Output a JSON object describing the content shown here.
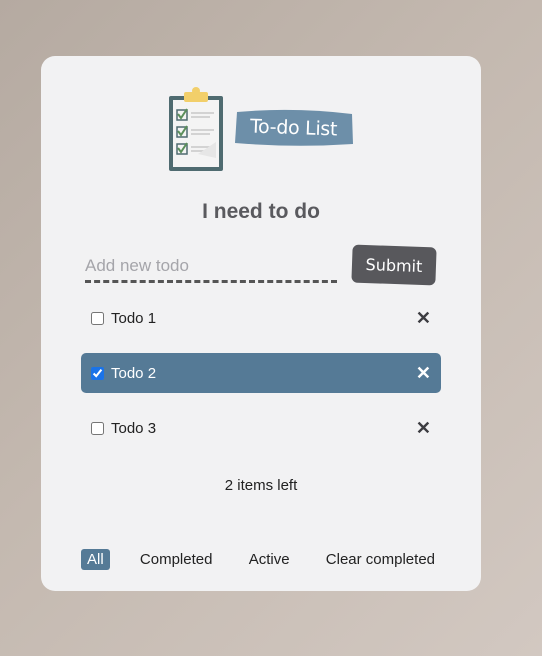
{
  "logo": {
    "label": "To-do List",
    "icon": "clipboard-checklist-icon"
  },
  "heading": "I need to do",
  "input": {
    "placeholder": "Add new todo",
    "value": ""
  },
  "submit_label": "Submit",
  "todos": [
    {
      "text": "Todo 1",
      "completed": false
    },
    {
      "text": "Todo 2",
      "completed": true
    },
    {
      "text": "Todo 3",
      "completed": false
    }
  ],
  "delete_glyph": "✕",
  "items_left": "2 items left",
  "filters": {
    "all": "All",
    "completed": "Completed",
    "active": "Active",
    "clear": "Clear completed",
    "selected": "All"
  },
  "colors": {
    "accent": "#557a96",
    "submit_bg": "#58585c",
    "card_bg": "#f2f2f3",
    "heading": "#5a5a5e"
  }
}
